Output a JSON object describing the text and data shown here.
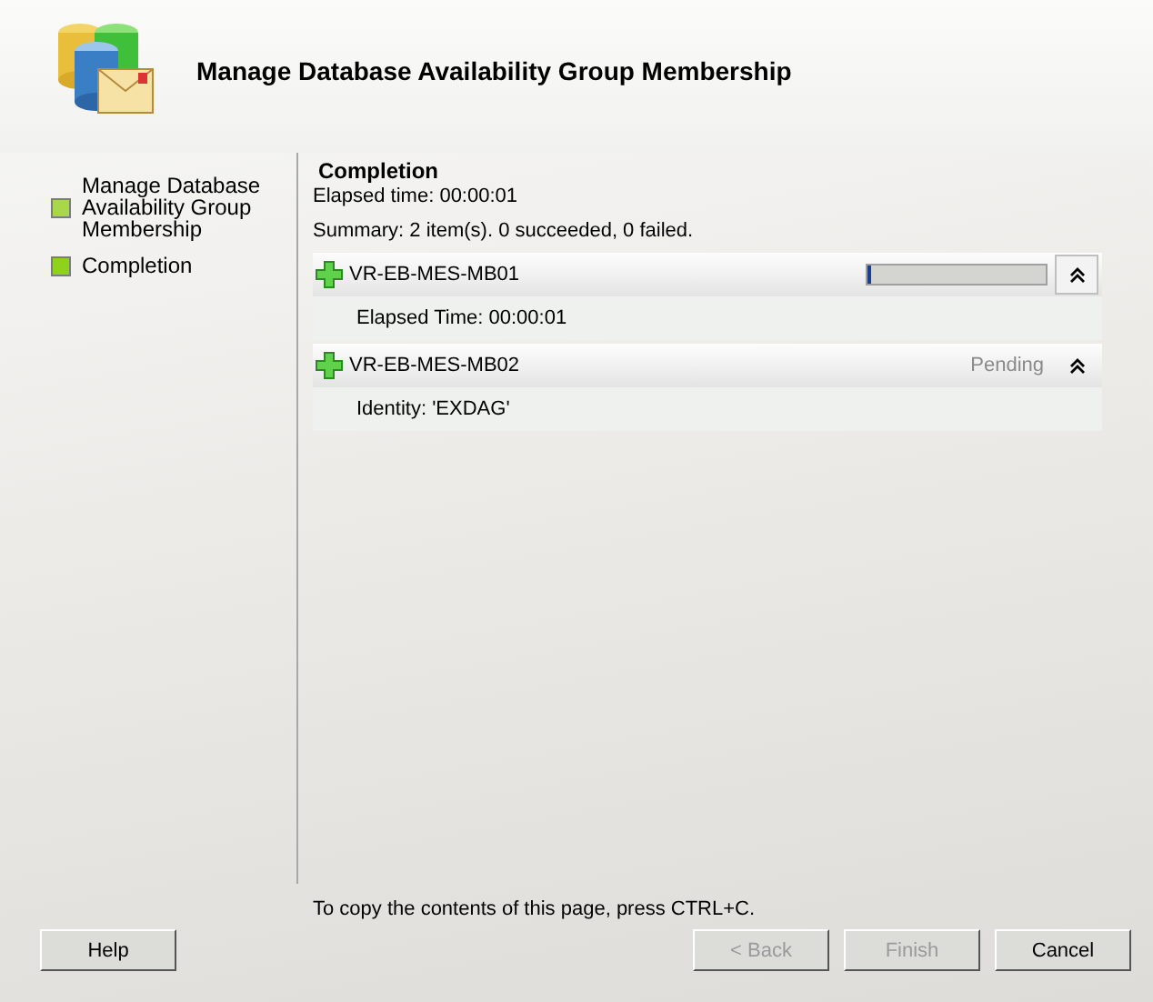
{
  "header": {
    "title": "Manage Database Availability Group Membership"
  },
  "steps": [
    {
      "label": "Manage Database Availability Group Membership",
      "selected": false
    },
    {
      "label": "Completion",
      "selected": true
    }
  ],
  "page": {
    "heading": "Completion",
    "elapsed": "Elapsed time: 00:00:01",
    "summary": "Summary: 2 item(s). 0 succeeded, 0 failed.",
    "items": [
      {
        "name": "VR-EB-MES-MB01",
        "kind": "progress",
        "level": 0.02,
        "expanded": true,
        "detail": "Elapsed Time: 00:00:01"
      },
      {
        "name": "VR-EB-MES-MB02",
        "kind": "status",
        "status": "Pending",
        "expanded": true,
        "detail": "Identity: 'EXDAG'"
      }
    ]
  },
  "footer": {
    "hint": "To copy the contents of this page, press CTRL+C."
  },
  "buttons": [
    {
      "label": "Help",
      "disabled": false,
      "kind": "left"
    },
    {
      "label": "< Back",
      "disabled": true,
      "kind": "right"
    },
    {
      "label": "Finish",
      "disabled": true,
      "kind": "right"
    },
    {
      "label": "Cancel",
      "disabled": false,
      "kind": "right"
    }
  ]
}
